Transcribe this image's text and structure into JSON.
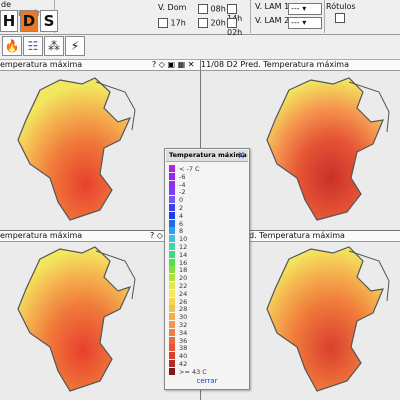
{
  "toolbar": {
    "prediction_title": "de Predicción",
    "hds": [
      "H",
      "D",
      "S"
    ],
    "v_dom_label": "V. Dom",
    "hours": [
      "08h",
      "14h",
      "17h",
      "20h",
      "02h"
    ],
    "v_lam1_label": "V. LAM 1",
    "v_lam2_label": "V. LAM 2",
    "lam1_value": "---",
    "lam2_value": "---",
    "rotulos_label": "Rótulos"
  },
  "panels": {
    "top_left_title": "emperatura máxima",
    "top_right_title": "11/08 D2 Pred. Temperatura máxima",
    "bottom_left_title": "emperatura máxima",
    "bottom_right_title": "d. Temperatura máxima"
  },
  "legend": {
    "title": "Temperatura máxima",
    "close": "X",
    "items": [
      {
        "label": "< -7 C",
        "color": "#b321e6"
      },
      {
        "label": "-6",
        "color": "#a020f0"
      },
      {
        "label": "-4",
        "color": "#8f2ff2"
      },
      {
        "label": "-2",
        "color": "#7f3ff5"
      },
      {
        "label": "0",
        "color": "#6a5cf2"
      },
      {
        "label": "2",
        "color": "#3f3ff0"
      },
      {
        "label": "4",
        "color": "#1f3fe6"
      },
      {
        "label": "6",
        "color": "#1f6fe6"
      },
      {
        "label": "8",
        "color": "#2f9ff0"
      },
      {
        "label": "10",
        "color": "#3fbfe6"
      },
      {
        "label": "12",
        "color": "#3fd6b0"
      },
      {
        "label": "14",
        "color": "#3fdc7f"
      },
      {
        "label": "16",
        "color": "#4fe04f"
      },
      {
        "label": "18",
        "color": "#7fe03f"
      },
      {
        "label": "20",
        "color": "#afe03f"
      },
      {
        "label": "22",
        "color": "#dfe84f"
      },
      {
        "label": "24",
        "color": "#f2e85f"
      },
      {
        "label": "26",
        "color": "#f5d64f"
      },
      {
        "label": "28",
        "color": "#f5c24f"
      },
      {
        "label": "30",
        "color": "#f5ad4f"
      },
      {
        "label": "32",
        "color": "#f5954f"
      },
      {
        "label": "34",
        "color": "#f07f3f"
      },
      {
        "label": "36",
        "color": "#eb6b3a"
      },
      {
        "label": "38",
        "color": "#e65535"
      },
      {
        "label": "40",
        "color": "#d93f2f"
      },
      {
        "label": "42",
        "color": "#b32a26"
      },
      {
        "label": ">= 43 C",
        "color": "#7a1a1a"
      }
    ],
    "cerrar": "cerrar"
  }
}
